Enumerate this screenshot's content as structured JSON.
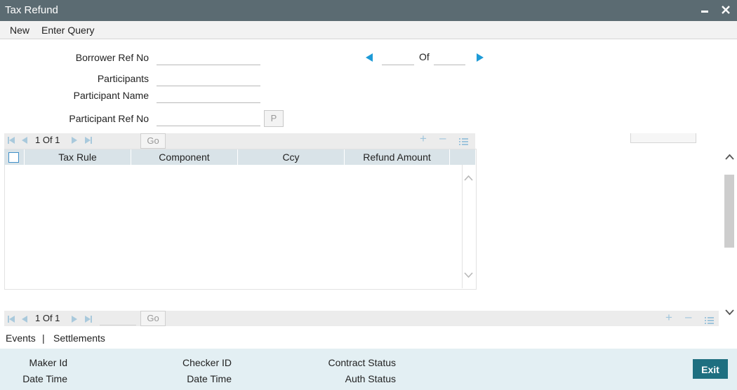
{
  "window": {
    "title": "Tax Refund"
  },
  "menu": {
    "new_label": "New",
    "enter_query_label": "Enter Query"
  },
  "form": {
    "borrower_ref_label": "Borrower Ref No",
    "borrower_ref_value": "",
    "participants_label": "Participants",
    "participants_value": "",
    "participant_name_label": "Participant Name",
    "participant_name_value": "",
    "participant_ref_label": "Participant Ref No",
    "participant_ref_value": "",
    "p_button_label": "P",
    "record_nav": {
      "current": "",
      "of_label": "Of",
      "total": ""
    }
  },
  "grid": {
    "pager_text": "1 Of 1",
    "go_label": "Go",
    "columns": [
      "Tax Rule",
      "Component",
      "Ccy",
      "Refund Amount"
    ],
    "rows": []
  },
  "bottom_pager": {
    "pager_text": "1 Of 1",
    "go_label": "Go"
  },
  "tabs": {
    "events_label": "Events",
    "separator": "|",
    "settlements_label": "Settlements"
  },
  "footer": {
    "maker_id_label": "Maker Id",
    "date_time_label_1": "Date Time",
    "checker_id_label": "Checker ID",
    "date_time_label_2": "Date Time",
    "contract_status_label": "Contract Status",
    "auth_status_label": "Auth Status",
    "exit_label": "Exit"
  },
  "colors": {
    "title_bar": "#5b6b72",
    "accent": "#1e9bd7",
    "exit_button": "#1e6f80",
    "grid_header": "#d9e3e8",
    "footer_bg": "#e3eff3"
  },
  "icons": [
    "minimize-icon",
    "close-icon",
    "prev-record-icon",
    "next-record-icon",
    "first-page-icon",
    "prev-page-icon",
    "next-page-icon",
    "last-page-icon",
    "add-row-icon",
    "delete-row-icon",
    "single-view-icon",
    "scroll-up-icon",
    "scroll-down-icon"
  ]
}
